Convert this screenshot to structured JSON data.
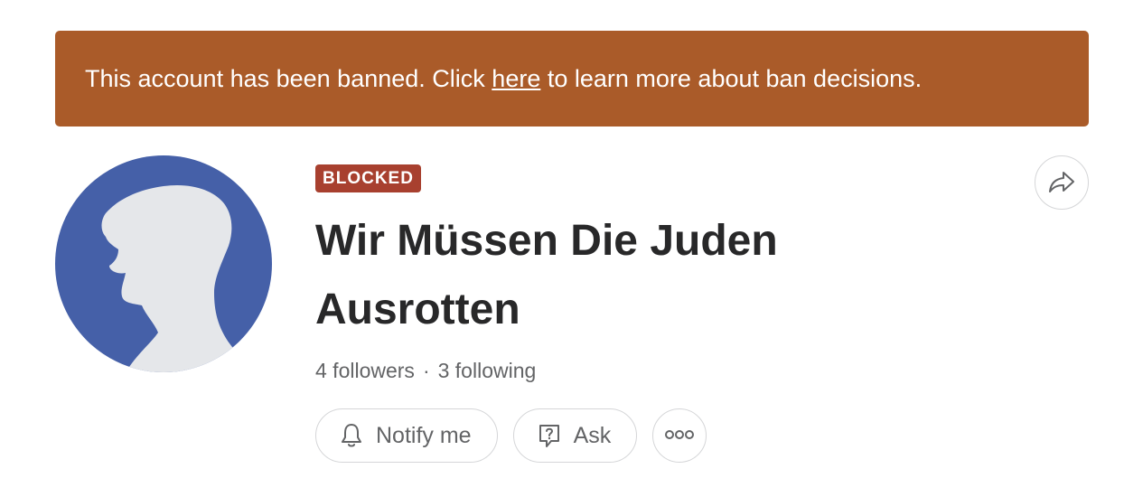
{
  "banner": {
    "text_before": "This account has been banned. Click ",
    "link": "here",
    "text_after": " to learn more about ban decisions.",
    "color": "#aa5b29"
  },
  "profile": {
    "badge": "BLOCKED",
    "badge_color": "#a8402f",
    "name": "Wir Müssen Die Juden Ausrotten",
    "followers": "4 followers",
    "separator": "·",
    "following": "3 following",
    "avatar_color": "#4560a8"
  },
  "actions": {
    "notify_label": "Notify me",
    "notify_icon": "bell-icon",
    "ask_label": "Ask",
    "ask_icon": "question-bubble-icon",
    "more_icon": "more-dots-icon",
    "share_icon": "share-arrow-icon"
  }
}
